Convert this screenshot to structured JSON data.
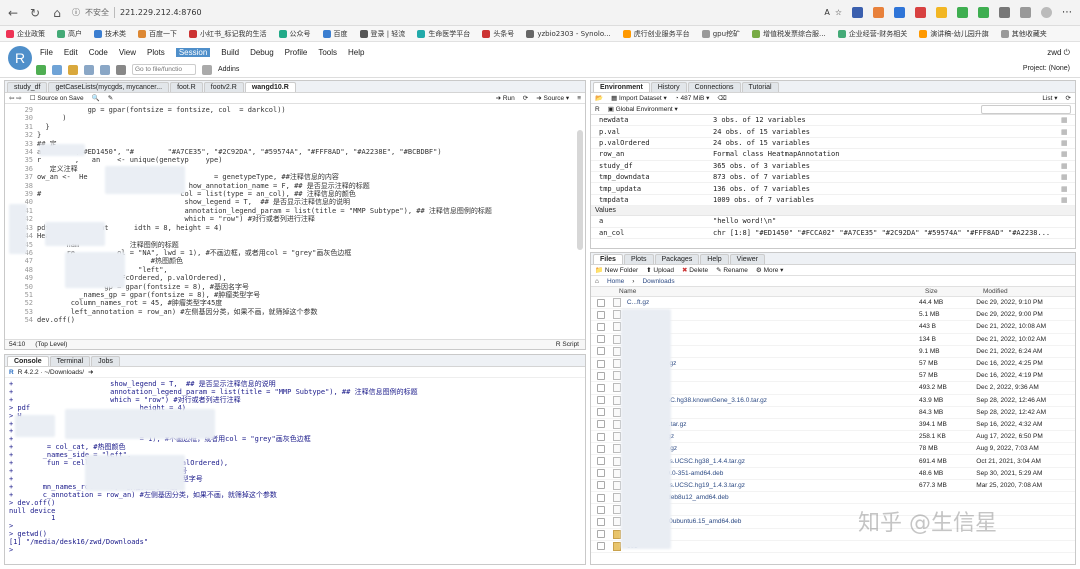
{
  "browser": {
    "warning": "不安全",
    "url": "221.229.212.4:8760",
    "bookmarks": [
      "企业政策",
      "高户",
      "技术类",
      "百度一下",
      "小红书_标记我的生活",
      "公众号",
      "百度",
      "登录 | 轻流",
      "生命医学平台",
      "头条号",
      "yzbio2303 - Synolo...",
      "虎行创业服务平台",
      "gpu挖矿",
      "增值税发票综合服...",
      "企业经营-财务相关",
      "演讲稿-幼儿园升旗",
      "其他收藏夹"
    ]
  },
  "rstudio": {
    "logo": "R",
    "menus": [
      "File",
      "Edit",
      "Code",
      "View",
      "Plots",
      "Session",
      "Build",
      "Debug",
      "Profile",
      "Tools",
      "Help"
    ],
    "active_menu": "Session",
    "user": "zwd",
    "goto_placeholder": "Go to file/functio",
    "addins": "Addins",
    "project": "Project: (None)"
  },
  "source": {
    "tabs": [
      "study_df",
      "getCaseLists(mycgds, mycancer...",
      "foot.R",
      "footv2.R",
      "wangd10.R"
    ],
    "source_on_save": "Source on Save",
    "run": "Run",
    "source_btn": "Source",
    "line_numbers": [
      "29",
      "30",
      "31",
      "32",
      "33",
      "34",
      "35",
      "36",
      "37",
      "38",
      "39",
      "40",
      "41",
      "42",
      "43",
      "44",
      "45",
      "46",
      "47",
      "48",
      "49",
      "50",
      "51",
      "52",
      "53",
      "54"
    ],
    "lines": [
      "            gp = gpar(fontsize = fontsize, col  = darkcol))",
      "      )",
      "  }",
      "}",
      "## 定",
      "an       (\"#ED1450\", \"#        \"#A7CE35\", \"#2C92DA\", \"#59574A\", \"#FFF8AD\", \"#A2238E\", \"#BCBDBF\")",
      "r        ,   an    <- unique(genetyp    ype)",
      "   定义注释",
      "ow_an <-  He                              = genetypeType, ##注释信息的内容",
      "                                    how_annotation_name = F, ## 是否显示注释的标题",
      "#                                 col = list(type = an_col), ## 注释信息的颜色",
      "                                   show_legend = T,  ## 是否显示注释信息的说明",
      "                                   annotation_legend_param = list(title = \"MMP Subtype\"), ## 注释信息图例的标题",
      "                                   which = \"row\") #对行或者列进行注释",
      "pdf(        kHeat      idth = 8, height = 4)",
      "Heat    (matri",
      "       nam            注释图例的标题",
      "       re          ol = \"NA\", lwd = 1), #不画边框，或者用col = \"grey\"画灰色边框",
      "       co                  #热图颜色",
      "                        \"left\",",
      "        cell_fun(logFcOrdered, p.valOrdered),",
      "                gp = gpar(fontsize = 8), #基因名字号",
      "          _names_gp = gpar(fontsize = 8), #肿瘤类型字号",
      "        column_names_rot = 45, #肿瘤类型字45度",
      "        left_annotation = row_an) #左侧基因分类，如果不画，就筛掉这个参数",
      "dev.off()"
    ],
    "position": "54:10",
    "scope": "(Top Level)",
    "filetype": "R Script"
  },
  "console": {
    "tabs": [
      "Console",
      "Terminal",
      "Jobs"
    ],
    "path": "R 4.2.2 · ~/Downloads/",
    "lines": [
      "+                       show_legend = T,  ## 是否显示注释信息的说明",
      "+                       annotation_legend_param = list(title = \"MMP Subtype\"), ## 注释信息图例的标题",
      "+                       which = \"row\") #对行或者列进行注释",
      "> pdf                          height = 4)",
      "> H",
      "+",
      "+",
      "+                              = 1), #不画边框，或者用col = \"grey\"画灰色边框",
      "+        = col_cat, #热图颜色",
      "+       _names_side = \"left\",",
      "+        fun = cell_fun(logFcOrdered, p.valOrdered),",
      "+                             ), #基因名字号",
      "+                               ), #肿瘤类型字号",
      "+       mn_names_rot = 45, #肿瘤类型字45度",
      "+       c_annotation = row_an) #左侧基因分类，如果不画，就筛掉这个参数",
      "> dev.off()",
      "null device",
      "          1",
      ">",
      "> getwd()",
      "[1] \"/media/desk16/zwd/Downloads\"",
      ">"
    ]
  },
  "environment": {
    "tabs": [
      "Environment",
      "History",
      "Connections",
      "Tutorial"
    ],
    "import": "Import Dataset",
    "memory": "487 MiB",
    "list_label": "List",
    "lang": "R",
    "scope": "Global Environment",
    "rows": [
      {
        "name": "newdata",
        "value": "3 obs. of 12 variables"
      },
      {
        "name": "p.val",
        "value": "24 obs. of 15 variables"
      },
      {
        "name": "p.valOrdered",
        "value": "24 obs. of 15 variables"
      },
      {
        "name": "row_an",
        "value": "Formal class  HeatmapAnnotation"
      },
      {
        "name": "study_df",
        "value": "365 obs. of 3 variables"
      },
      {
        "name": "tmp_downdata",
        "value": "873 obs. of 7 variables"
      },
      {
        "name": "tmp_updata",
        "value": "136 obs. of 7 variables"
      },
      {
        "name": "tmpdata",
        "value": "1009 obs. of 7 variables"
      }
    ],
    "values_header": "Values",
    "values": [
      {
        "name": "a",
        "value": "\"hello word!\\n\""
      },
      {
        "name": "an_col",
        "value": "chr [1:8] \"#ED1450\" \"#FCCA02\" \"#A7CE35\" \"#2C92DA\" \"#59574A\" \"#FFF8AD\" \"#A2238..."
      }
    ]
  },
  "files": {
    "tabs": [
      "Files",
      "Plots",
      "Packages",
      "Help",
      "Viewer"
    ],
    "new_folder": "New Folder",
    "upload": "Upload",
    "delete": "Delete",
    "rename": "Rename",
    "more": "More",
    "breadcrumb": [
      "Home",
      "Downloads"
    ],
    "col_name": "Name",
    "col_size": "Size",
    "col_modified": "Modified",
    "rows": [
      {
        "name": "C...ft.gz",
        "size": "44.4 MB",
        "modified": "Dec 29, 2022, 9:10 PM",
        "folder": false
      },
      {
        "name": "...nRNAsi.xlsx",
        "size": "5.1 MB",
        "modified": "Dec 29, 2022, 9:00 PM",
        "folder": false
      },
      {
        "name": "...s.sh",
        "size": "443 B",
        "modified": "Dec 21, 2022, 10:08 AM",
        "folder": false
      },
      {
        "name": "...",
        "size": "134 B",
        "modified": "Dec 21, 2022, 10:02 AM",
        "folder": false
      },
      {
        "name": "...phToBigWig",
        "size": "9.1 MB",
        "modified": "Dec 21, 2022, 6:24 AM",
        "folder": false
      },
      {
        "name": "...F1000V2.tar.gz",
        "size": "57 MB",
        "modified": "Dec 16, 2022, 4:25 PM",
        "folder": false
      },
      {
        "name": "...master.zip",
        "size": "57 MB",
        "modified": "Dec 16, 2022, 4:19 PM",
        "folder": false
      },
      {
        "name": "...5.tar.gz",
        "size": "493.2 MB",
        "modified": "Dec 2, 2022, 9:36 AM",
        "folder": false
      },
      {
        "name": "...sapiens.UCSC.hg38.knownGene_3.16.0.tar.gz",
        "size": "43.9 MB",
        "modified": "Sep 28, 2022, 12:46 AM",
        "folder": false
      },
      {
        "name": "...3.16.0.tar.gz",
        "size": "84.3 MB",
        "modified": "Sep 28, 2022, 12:42 AM",
        "folder": false
      },
      {
        "name": "...ura...a_3.1.0.tar.gz",
        "size": "394.1 MB",
        "modified": "Sep 16, 2022, 4:32 AM",
        "folder": false
      },
      {
        "name": "...Rpl...9.6.tar.gz",
        "size": "258.1 KB",
        "modified": "Aug 17, 2022, 6:50 PM",
        "folder": false
      },
      {
        "name": "...g...3.10.0.tar.gz",
        "size": "78 MB",
        "modified": "Aug 9, 2022, 7:03 AM",
        "folder": false
      },
      {
        "name": "...omo...sapiens.UCSC.hg38_1.4.4.tar.gz",
        "size": "691.4 MB",
        "modified": "Oct 21, 2021, 3:04 AM",
        "folder": false
      },
      {
        "name": "...o-s...2021.09.0-351-amd64.deb",
        "size": "48.6 MB",
        "modified": "Sep 30, 2021, 5:29 AM",
        "folder": false
      },
      {
        "name": "...omo...sapiens.UCSC.hg19_1.4.3.tar.gz",
        "size": "677.3 MB",
        "modified": "Mar 25, 2020, 7:08 AM",
        "folder": false
      },
      {
        "name": "...1.0...0.1t-1+deb8u12_amd64.deb",
        "size": "",
        "modified": "",
        "folder": false
      },
      {
        "name": "...1...tar.gz",
        "size": "",
        "modified": "",
        "folder": false
      },
      {
        "name": "...upport_2.19-0ubuntu6.15_amd64.deb",
        "size": "",
        "modified": "",
        "folder": false
      },
      {
        "name": "473",
        "size": "",
        "modified": "",
        "folder": true
      },
      {
        "name": "603",
        "size": "",
        "modified": "",
        "folder": true
      }
    ]
  },
  "watermark": "知乎 @生信星"
}
